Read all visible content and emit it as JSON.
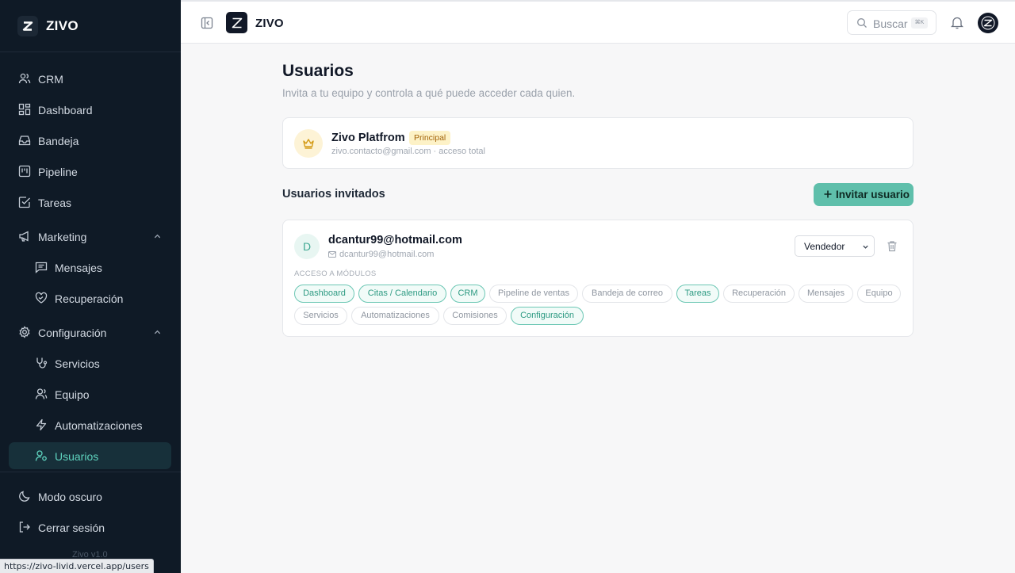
{
  "sidebar": {
    "brand": "ZIVO",
    "items": [
      {
        "label": "CRM",
        "icon": "users-icon"
      },
      {
        "label": "Dashboard",
        "icon": "grid-icon"
      },
      {
        "label": "Bandeja",
        "icon": "inbox-icon"
      },
      {
        "label": "Pipeline",
        "icon": "kanban-icon"
      },
      {
        "label": "Tareas",
        "icon": "checkbox-icon"
      },
      {
        "label": "Marketing",
        "icon": "megaphone-icon"
      },
      {
        "label": "Mensajes",
        "icon": "message-icon"
      },
      {
        "label": "Recuperación",
        "icon": "heart-handshake-icon"
      },
      {
        "label": "Configuración",
        "icon": "gear-icon"
      },
      {
        "label": "Servicios",
        "icon": "stethoscope-icon"
      },
      {
        "label": "Equipo",
        "icon": "team-icon"
      },
      {
        "label": "Automatizaciones",
        "icon": "lightning-icon"
      },
      {
        "label": "Usuarios",
        "icon": "user-key-icon"
      }
    ],
    "dark_mode_label": "Modo oscuro",
    "logout_label": "Cerrar sesión",
    "version": "Zivo v1.0"
  },
  "status_url": "https://zivo-livid.vercel.app/users",
  "topbar": {
    "brand": "ZIVO",
    "search_placeholder": "Buscar",
    "search_shortcut": "⌘K"
  },
  "main": {
    "title": "Usuarios",
    "subtitle": "Invita a tu equipo y controla a qué puede acceder cada quien.",
    "owner": {
      "name": "Zivo Platfrom",
      "badge": "Principal",
      "detail": "zivo.contacto@gmail.com · acceso total"
    },
    "invited_title": "Usuarios invitados",
    "invite_button": "Invitar usuario",
    "users": [
      {
        "initial": "D",
        "name": "dcantur99@hotmail.com",
        "email": "dcantur99@hotmail.com",
        "role": "Vendedor",
        "modules_label": "ACCESO A MÓDULOS",
        "modules": [
          {
            "label": "Dashboard",
            "active": true
          },
          {
            "label": "Citas / Calendario",
            "active": true
          },
          {
            "label": "CRM",
            "active": true
          },
          {
            "label": "Pipeline de ventas",
            "active": false
          },
          {
            "label": "Bandeja de correo",
            "active": false
          },
          {
            "label": "Tareas",
            "active": true
          },
          {
            "label": "Recuperación",
            "active": false
          },
          {
            "label": "Mensajes",
            "active": false
          },
          {
            "label": "Equipo",
            "active": false
          },
          {
            "label": "Servicios",
            "active": false
          },
          {
            "label": "Automatizaciones",
            "active": false
          },
          {
            "label": "Comisiones",
            "active": false
          },
          {
            "label": "Configuración",
            "active": true
          }
        ]
      }
    ]
  },
  "colors": {
    "sidebar_bg": "#0f1a26",
    "accent": "#5fbfab",
    "accent_text": "#2d9a82",
    "badge_bg": "#fdf2c7"
  }
}
